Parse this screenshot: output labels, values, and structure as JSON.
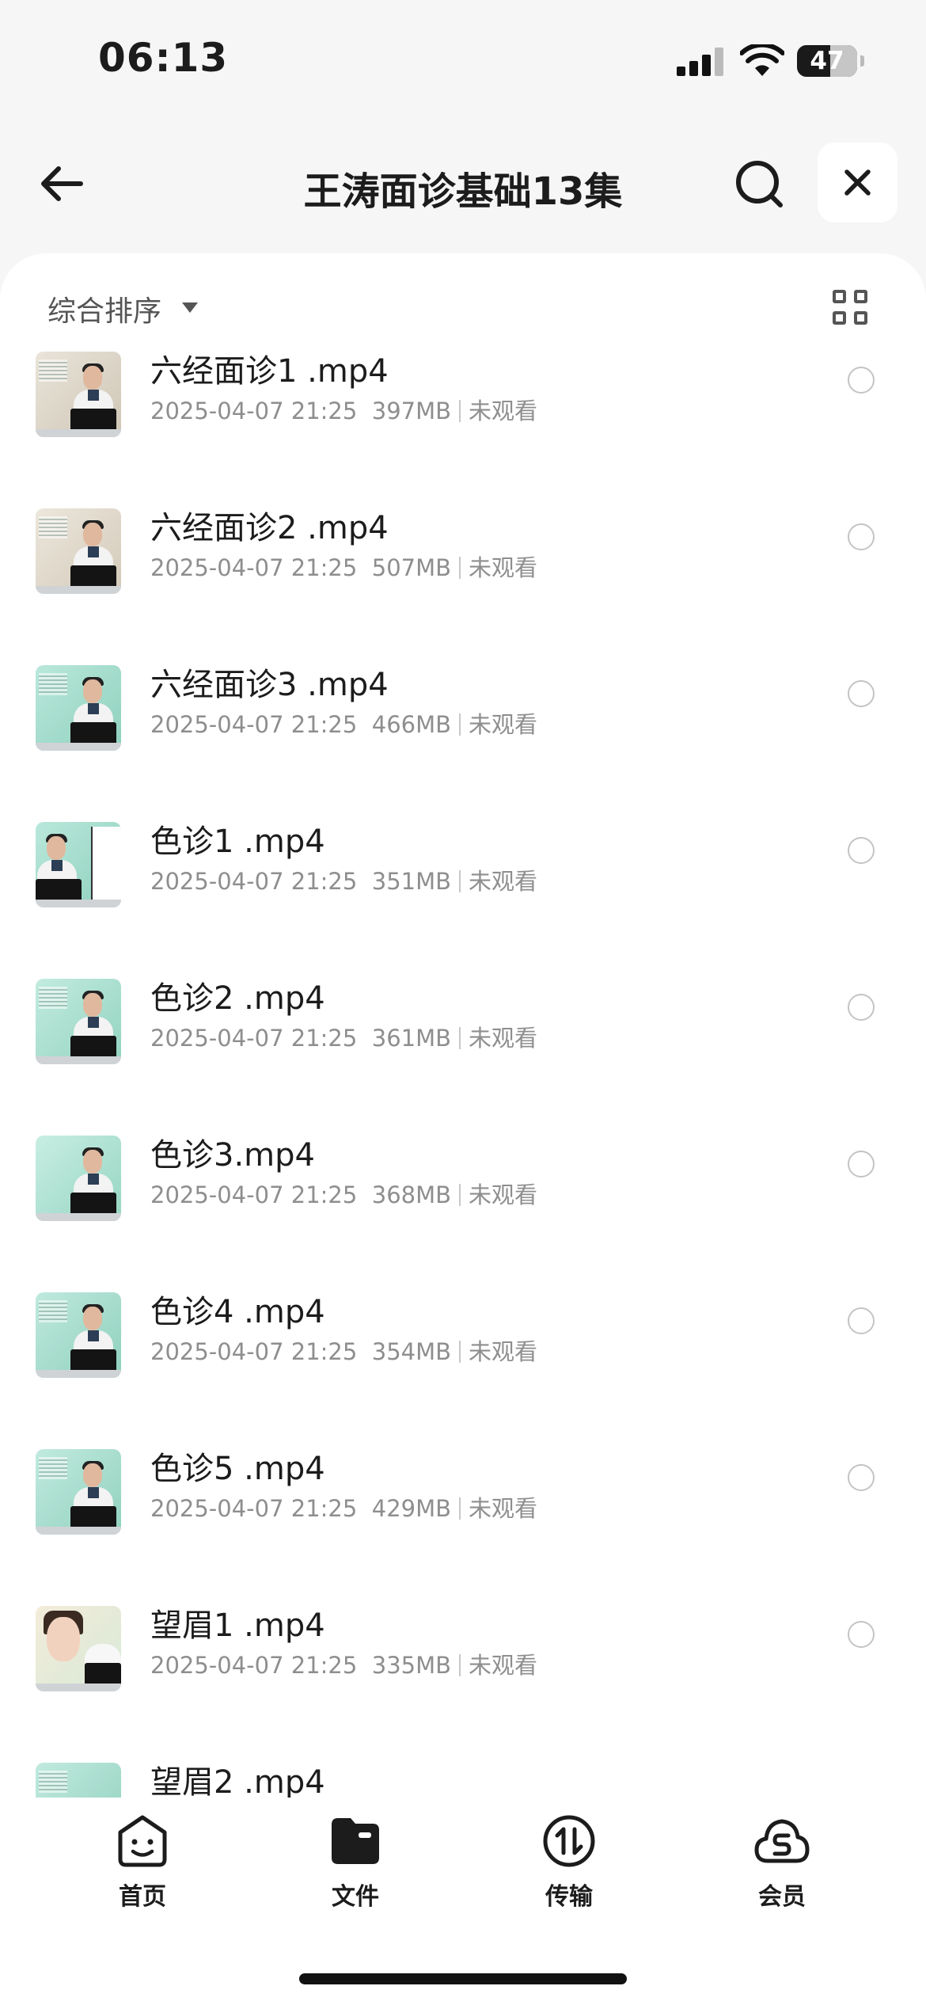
{
  "status_bar": {
    "time": "06:13",
    "battery_level": "47"
  },
  "nav": {
    "title": "王涛面诊基础13集",
    "icons": [
      "arrow-left-icon",
      "search-icon",
      "close-icon"
    ]
  },
  "toolbar": {
    "sort_label": "综合排序",
    "icons": [
      "caret-down-icon",
      "grid-view-icon"
    ]
  },
  "files": [
    {
      "name": "六经面诊1 .mp4",
      "date": "2025-04-07 21:25",
      "size": "397MB",
      "status": "未观看",
      "thumb": "classroom"
    },
    {
      "name": "六经面诊2 .mp4",
      "date": "2025-04-07 21:25",
      "size": "507MB",
      "status": "未观看",
      "thumb": "classroom"
    },
    {
      "name": "六经面诊3 .mp4",
      "date": "2025-04-07 21:25",
      "size": "466MB",
      "status": "未观看",
      "thumb": "teal"
    },
    {
      "name": "色诊1 .mp4",
      "date": "2025-04-07 21:25",
      "size": "351MB",
      "status": "未观看",
      "thumb": "face-drawing"
    },
    {
      "name": "色诊2 .mp4",
      "date": "2025-04-07 21:25",
      "size": "361MB",
      "status": "未观看",
      "thumb": "teal"
    },
    {
      "name": "色诊3.mp4",
      "date": "2025-04-07 21:25",
      "size": "368MB",
      "status": "未观看",
      "thumb": "teal"
    },
    {
      "name": "色诊4 .mp4",
      "date": "2025-04-07 21:25",
      "size": "354MB",
      "status": "未观看",
      "thumb": "teal"
    },
    {
      "name": "色诊5 .mp4",
      "date": "2025-04-07 21:25",
      "size": "429MB",
      "status": "未观看",
      "thumb": "teal"
    },
    {
      "name": "望眉1 .mp4",
      "date": "2025-04-07 21:25",
      "size": "335MB",
      "status": "未观看",
      "thumb": "woman"
    },
    {
      "name": "望眉2 .mp4",
      "date": "",
      "size": "",
      "status": "",
      "thumb": "teal"
    }
  ],
  "tabs": [
    {
      "label": "首页",
      "icon": "smiley-home-icon"
    },
    {
      "label": "文件",
      "icon": "folder-icon"
    },
    {
      "label": "传输",
      "icon": "transfer-icon"
    },
    {
      "label": "会员",
      "icon": "cloud-vip-icon"
    }
  ],
  "colors": {
    "background": "#f6f6f6",
    "sheet": "#ffffff",
    "text": "#1c1c1c",
    "meta": "#8e8e8e",
    "accent_teal": "#9fd9c8"
  }
}
